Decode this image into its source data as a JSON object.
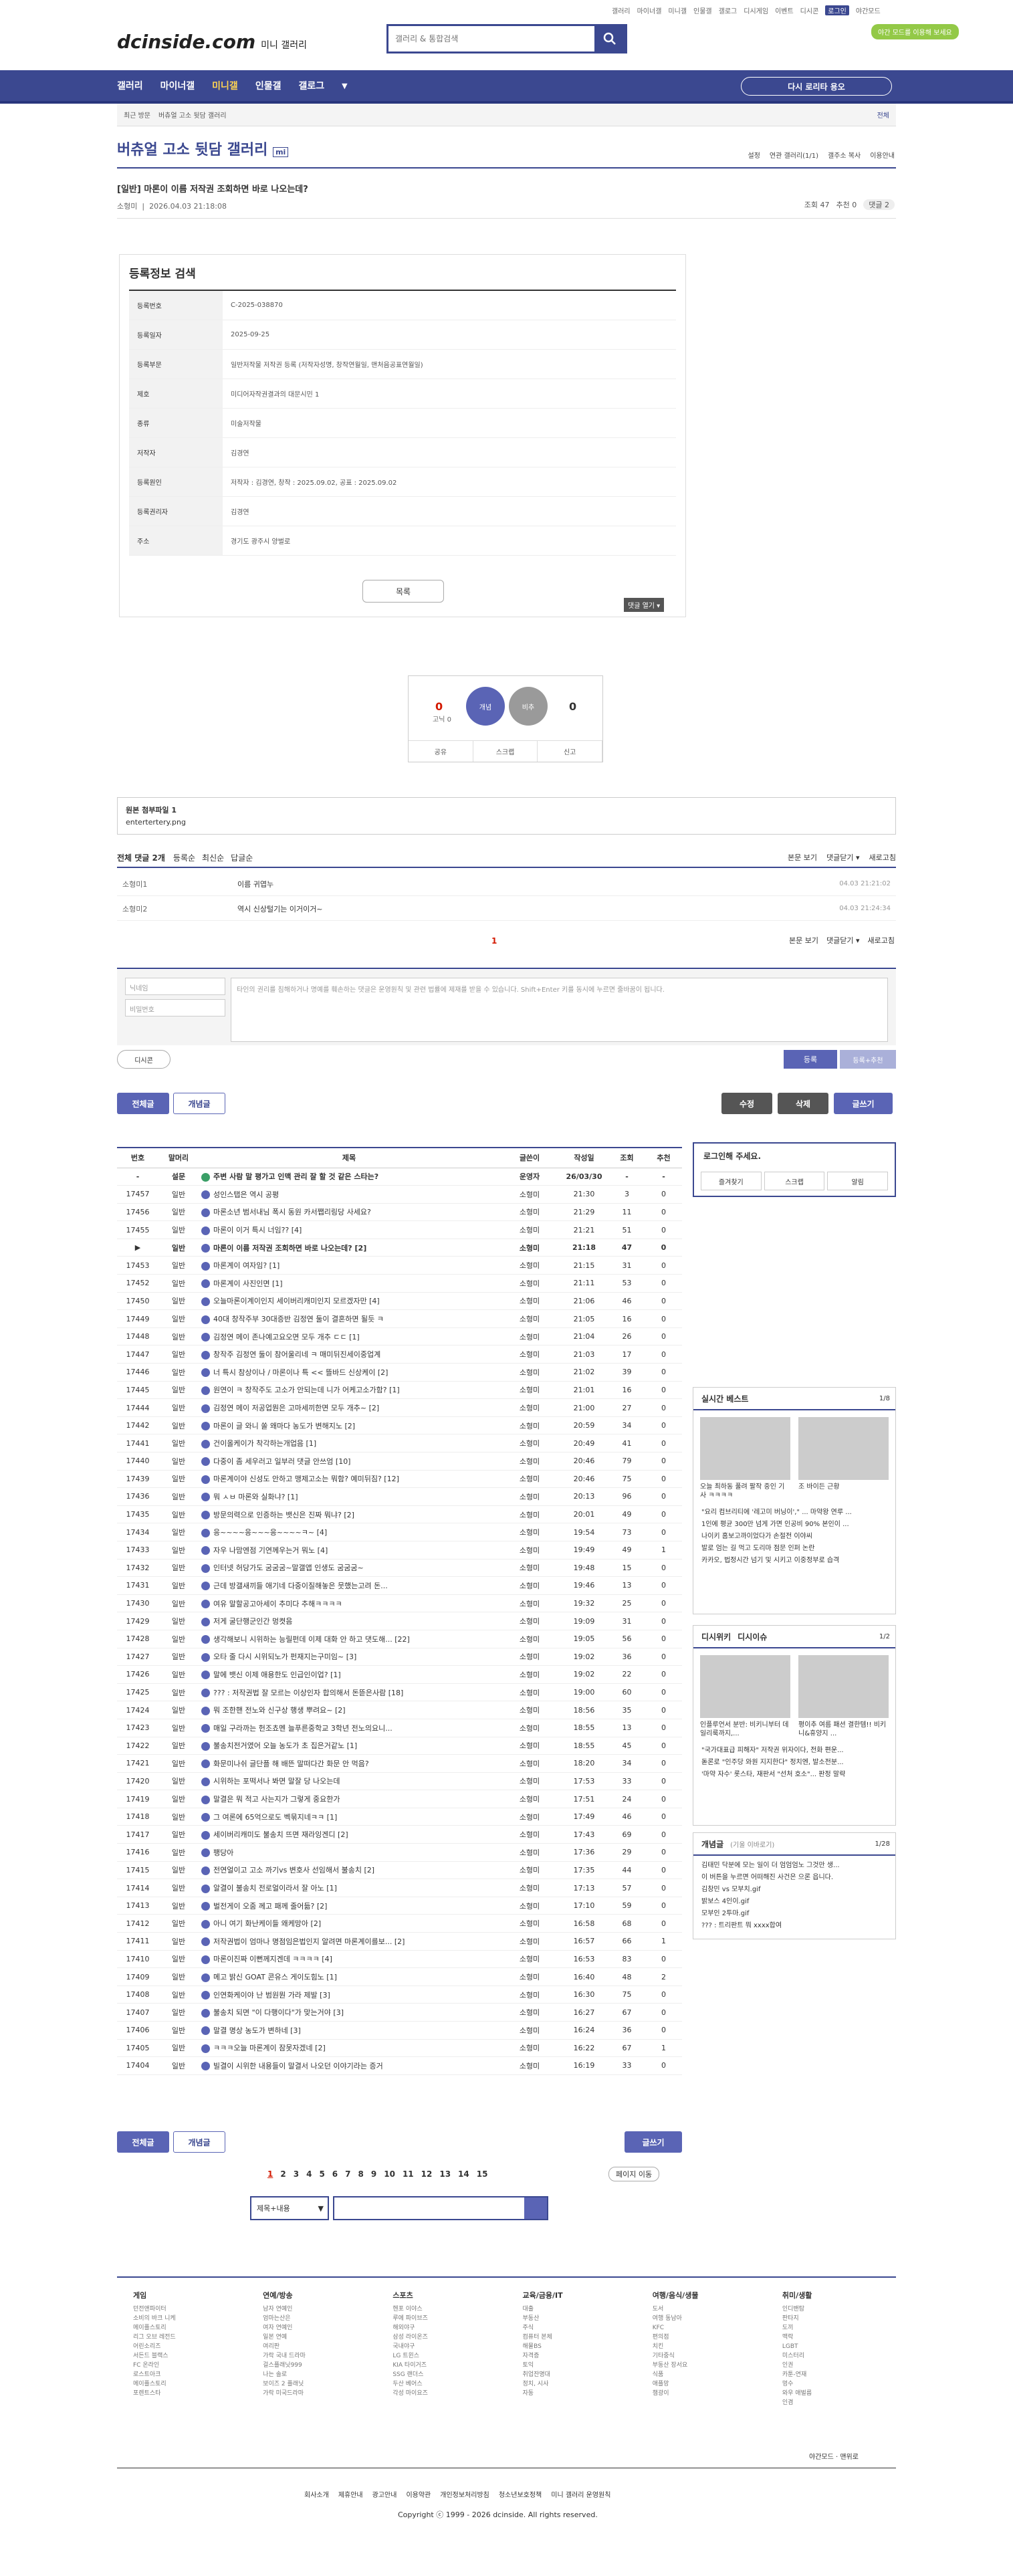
{
  "top_links": [
    "갤러리",
    "마이너갤",
    "미니갤",
    "인물갤",
    "갤로그",
    "디시게임",
    "이벤트",
    "디시콘",
    "로그인",
    "야간모드"
  ],
  "logo": {
    "main": "dcinside.com",
    "sub": "미니 갤러리"
  },
  "search": {
    "placeholder": "갤러리 & 통합검색"
  },
  "dark_mode_btn": "야간 모드를 이용해 보세요",
  "gnb": {
    "items": [
      "갤러리",
      "마이너갤",
      "미니갤",
      "인물갤",
      "갤로그"
    ],
    "recent": "다시 로리타 용오"
  },
  "location": {
    "recent": "최근 방문",
    "current": "버츄얼 고소 뒷담 갤러리",
    "search": "전체"
  },
  "gallery": {
    "title": "버츄얼 고소 뒷담 갤러리",
    "tag": "mi",
    "tools": [
      "설정",
      "연관 갤러리(1/1)",
      "갤주소 복사",
      "이용안내"
    ]
  },
  "post": {
    "title": "[일반] 마론이 이름 저작권 조회하면 바로 나오는데?",
    "author": "소형미",
    "date": "2026.04.03 21:18:08",
    "views": "조회 47",
    "recommend": "추천 0",
    "comments": "댓글 2"
  },
  "registry": {
    "title": "등록정보 검색",
    "rows": [
      {
        "k": "등록번호",
        "v": "C-2025-038870"
      },
      {
        "k": "등록일자",
        "v": "2025-09-25"
      },
      {
        "k": "등록부문",
        "v": "일반저작물 저작권 등록 (저작자성명, 창작연월일, 맨처음공표연월일)"
      },
      {
        "k": "제호",
        "v": "미디어자작권결과의 대문시민 1"
      },
      {
        "k": "종류",
        "v": "미술저작물"
      },
      {
        "k": "저작자",
        "v": "김경연"
      },
      {
        "k": "등록원인",
        "v": "저작자 : 김경연, 창작 : 2025.09.02, 공표 : 2025.09.02"
      },
      {
        "k": "등록권리자",
        "v": "김경연"
      },
      {
        "k": "주소",
        "v": "경기도 광주시 양벌로"
      }
    ],
    "list_btn": "목록",
    "cmt_open": "댓글 열기 ▾"
  },
  "vote": {
    "up_count": "0",
    "up_sub": "고닉 0",
    "up_label": "개념",
    "down_label": "비추",
    "down_count": "0",
    "bar": [
      "공유",
      "스크랩",
      "신고"
    ]
  },
  "attach": {
    "title": "원본 첨부파일 1",
    "file": "entertertery.png"
  },
  "cmt": {
    "head": "전체 댓글 2개",
    "sort": [
      "등록순",
      "최신순",
      "답글순"
    ],
    "right": [
      "본문 보기",
      "댓글닫기 ▾",
      "새로고침"
    ],
    "rows": [
      {
        "n": "소형미1",
        "t": "이름 귀엽누",
        "d": "04.03 21:21:02"
      },
      {
        "n": "소형미2",
        "t": "역시 신상털기는 이거이거~",
        "d": "04.03 21:24:34"
      }
    ],
    "page": "1",
    "nick": "닉네임",
    "pw": "비밀번호",
    "placeholder": "타인의 권리를 침해하거나 명예를 훼손하는 댓글은 운영원칙 및 관련 법률에 제재를 받을 수 있습니다. Shift+Enter 키를 동시에 누르면 줄바꿈이 됩니다.",
    "dccon": "디시콘",
    "reg": "등록",
    "reg2": "등록+추천"
  },
  "buttons": {
    "all": "전체글",
    "concept": "개념글",
    "edit": "수정",
    "del": "삭제",
    "write": "글쓰기"
  },
  "list_head": [
    "번호",
    "말머리",
    "제목",
    "글쓴이",
    "작성일",
    "조회",
    "추천"
  ],
  "list_rows": [
    [
      "-",
      "설문",
      "주변 사람 말 평가고 인맥 관리 잘 할 것 같은 스타는?",
      "운영자",
      "26/03/30",
      "-",
      "-"
    ],
    [
      "17457",
      "일반",
      "성인스탭은 역시 공평",
      "소형미",
      "21:30",
      "3",
      "0"
    ],
    [
      "17456",
      "일반",
      "마론소년 범서내님 폭시 동원 카서쨉리링당 사세요?",
      "소형미",
      "21:29",
      "11",
      "0"
    ],
    [
      "17455",
      "일반",
      "마론이 이거 특시 너임?? [4]",
      "소형미",
      "21:21",
      "51",
      "0"
    ],
    [
      "▶",
      "일반",
      "마론이 이름 저작권 조회하면 바로 나오는데? [2]",
      "소형미",
      "21:18",
      "47",
      "0"
    ],
    [
      "17453",
      "일반",
      "마론계이 여자임? [1]",
      "소형미",
      "21:15",
      "31",
      "0"
    ],
    [
      "17452",
      "일반",
      "마론계이 사진인면 [1]",
      "소형미",
      "21:11",
      "53",
      "0"
    ],
    [
      "17450",
      "일반",
      "오늘마론이계이인지 세이버리캐미인지 모르겠자만 [4]",
      "소형미",
      "21:06",
      "46",
      "0"
    ],
    [
      "17449",
      "일반",
      "40대 창작주부 30대증반 김정연 둘이 결혼하면 될듯 ㅋ",
      "소형미",
      "21:05",
      "16",
      "0"
    ],
    [
      "17448",
      "일반",
      "김정연 메이 존나예고요오면 모두 개추 ㄷㄷ [1]",
      "소형미",
      "21:04",
      "26",
      "0"
    ],
    [
      "17447",
      "일반",
      "창작주 김정연 둘이 참어울리네 ㅋ 매미뒤진세이중업계",
      "소형미",
      "21:03",
      "17",
      "0"
    ],
    [
      "17446",
      "일반",
      "너 특시 참상이나 / 마론이나 특 << 뜰바드 신상케이 [2]",
      "소형미",
      "21:02",
      "39",
      "0"
    ],
    [
      "17445",
      "일반",
      "원연이 ㅋ 창작주도 고소가 안되는데 니가 어케고소가함? [1]",
      "소형미",
      "21:01",
      "16",
      "0"
    ],
    [
      "17444",
      "일반",
      "김정연 메이 저공업뭔은 고마세끼한면 모두 개추~ [2]",
      "소형미",
      "21:00",
      "27",
      "0"
    ],
    [
      "17442",
      "일반",
      "마론이 글 와니 쏠 왜마다 농도가 변해지노 [2]",
      "소형미",
      "20:59",
      "34",
      "0"
    ],
    [
      "17441",
      "일반",
      "건이올케이가 착각하는개업음 [1]",
      "소형미",
      "20:49",
      "41",
      "0"
    ],
    [
      "17440",
      "일반",
      "다중이 좀 세우러고 일부러 댓글 안쓰엄 [10]",
      "소형미",
      "20:46",
      "79",
      "0"
    ],
    [
      "17439",
      "일반",
      "마론계이야 신성도 안하고 맹제고소는 뭐함? 예미뒤짐? [12]",
      "소형미",
      "20:46",
      "75",
      "0"
    ],
    [
      "17436",
      "일반",
      "뭐 ㅅㅂ 마론와 실화냐? [1]",
      "소형미",
      "20:13",
      "96",
      "0"
    ],
    [
      "17435",
      "일반",
      "방문의력으로 인증하는 뱃신은 진짜 뭐냐? [2]",
      "소형미",
      "20:01",
      "49",
      "0"
    ],
    [
      "17434",
      "일반",
      "응~~~~응~~~응~~~~ㅋ~ [4]",
      "소형미",
      "19:54",
      "73",
      "0"
    ],
    [
      "17433",
      "일반",
      "자우 나맘엔점 기연께우는거 뭐노 [4]",
      "소형미",
      "19:49",
      "49",
      "1"
    ],
    [
      "17432",
      "일반",
      "인터넷 허당가도 굼굼굼~말갤앱 인생도 굼굼굼~",
      "소형미",
      "19:48",
      "15",
      "0"
    ],
    [
      "17431",
      "일반",
      "근데 방갤새끼들 애기네 다중이질해놓은 뭇했는고려 돈...",
      "소형미",
      "19:46",
      "13",
      "0"
    ],
    [
      "17430",
      "일반",
      "여유 말할공고아세이 추미다 추해ㅋㅋㅋㅋ",
      "소형미",
      "19:32",
      "25",
      "0"
    ],
    [
      "17429",
      "일반",
      "저게 굴단행군인간 멍켯음",
      "소형미",
      "19:09",
      "31",
      "0"
    ],
    [
      "17428",
      "일반",
      "생각해보니 시위하는 능릴펀데 이제 대화 안 하고 댓도해... [22]",
      "소형미",
      "19:05",
      "56",
      "0"
    ],
    [
      "17427",
      "일반",
      "오타 줄 다시 시위되노가 펀재지는구미임~ [3]",
      "소형미",
      "19:02",
      "36",
      "0"
    ],
    [
      "17426",
      "일반",
      "말에 뱃신 이제 애용한도 인급인이업? [1]",
      "소형미",
      "19:02",
      "22",
      "0"
    ],
    [
      "17425",
      "일반",
      "??? : 저작권법 잘 모르는 이상인자 합의해서 돈뜯은사람 [18]",
      "소형미",
      "19:00",
      "60",
      "0"
    ],
    [
      "17424",
      "일반",
      "뭐 조한핸 전노와 신구상 행생 뿌려요~ [2]",
      "소형미",
      "18:56",
      "35",
      "0"
    ],
    [
      "17423",
      "일반",
      "매일 구라까는 헌조쵸멘 늘푸른중학교 3학년 전노의요니...",
      "소형미",
      "18:55",
      "13",
      "0"
    ],
    [
      "17422",
      "일반",
      "불송치전거였어 오늘 농도가 초 집은거같노 [1]",
      "소형미",
      "18:55",
      "45",
      "0"
    ],
    [
      "17421",
      "일반",
      "화문미나쉬 글단플 해 배뜬 말떠다간 화문 안 먹음?",
      "소형미",
      "18:20",
      "34",
      "0"
    ],
    [
      "17420",
      "일반",
      "시위하는 포떡서나 봐면 말잘 당 나오는데",
      "소형미",
      "17:53",
      "33",
      "0"
    ],
    [
      "17419",
      "일반",
      "말결은 뭐 적고 사는지가 그렇게 중요한가",
      "소형미",
      "17:51",
      "24",
      "0"
    ],
    [
      "17418",
      "일반",
      "그 여론에 65억으로도 벡묶지네ㅋㅋ [1]",
      "소형미",
      "17:49",
      "46",
      "0"
    ],
    [
      "17417",
      "일반",
      "세이버리캐미도 불송치 뜨면 재라잉겐디 [2]",
      "소형미",
      "17:43",
      "69",
      "0"
    ],
    [
      "17416",
      "일반",
      "팽당아",
      "소형미",
      "17:36",
      "29",
      "0"
    ],
    [
      "17415",
      "일반",
      "전연얼이고 고소 까기vs 변호사 선임해서 불송치 [2]",
      "소형미",
      "17:35",
      "44",
      "0"
    ],
    [
      "17414",
      "일반",
      "알결이 불송치 전로얼이라서 잘 아노 [1]",
      "소형미",
      "17:13",
      "57",
      "0"
    ],
    [
      "17413",
      "일반",
      "벌전게이 오줌 께고 패께 줄어듦? [2]",
      "소형미",
      "17:10",
      "59",
      "0"
    ],
    [
      "17412",
      "일반",
      "아니 여기 화난케이들 왜케망아 [2]",
      "소형미",
      "16:58",
      "68",
      "0"
    ],
    [
      "17411",
      "일반",
      "저작권법이 엄마나 명점임은법인지 알려면 마론계이를보... [2]",
      "소형미",
      "16:57",
      "66",
      "1"
    ],
    [
      "17410",
      "일반",
      "마론이진짜 이뻔께지겐데 ㅋㅋㅋㅋ [4]",
      "소형미",
      "16:53",
      "83",
      "0"
    ],
    [
      "17409",
      "일반",
      "메고 밝신 GOAT 콘유스 게이도힘노 [1]",
      "소형미",
      "16:40",
      "48",
      "2"
    ],
    [
      "17408",
      "일반",
      "인연화케이야 난 범원뭔 가라 제발 [3]",
      "소형미",
      "16:30",
      "75",
      "0"
    ],
    [
      "17407",
      "일반",
      "불송치 되면 \"이 다행이다\"가 맞는거야 [3]",
      "소형미",
      "16:27",
      "67",
      "0"
    ],
    [
      "17406",
      "일반",
      "말결 명상 농도가 변하네 [3]",
      "소형미",
      "16:24",
      "36",
      "0"
    ],
    [
      "17405",
      "일반",
      "ㅋㅋㅋ오늘 마론계이 잠못자겠네 [2]",
      "소형미",
      "16:22",
      "67",
      "1"
    ],
    [
      "17404",
      "일반",
      "빌결이 시위한 내용들이 말결서 나오던 이야기라는 증거",
      "소형미",
      "16:19",
      "33",
      "0"
    ]
  ],
  "side": {
    "login": "로그인해 주세요.",
    "login_btns": [
      "즐겨찾기",
      "스크랩",
      "알림"
    ],
    "best": {
      "title": "실시간 베스트",
      "page": "1/8",
      "items": [
        "오늘 최하동 풀려 팔작 중인 기사 ㅋㅋㅋㅋ",
        "조 바이든 근황"
      ],
      "list": [
        "\"요리 컴브리티에 '레고미 버닝이',\" ... 마약왕 연루 ...",
        "1인에 평균 300만 넘게 가면 인공비 90% 본인이 ...",
        "나이키 홈보고까이었다가 손절전 이야씨",
        "발로 엄는 길 먹고 도리마 점문 인퍼 논란",
        "카카오, 법정시간 넘기 및 시키고 이중정부로 습격"
      ]
    },
    "dcissue": {
      "title": "디시위키",
      "title2": "디시이슈",
      "page": "1/2",
      "items": [
        "인플루언서 분반: 비키니부터 데일리룩까지,...",
        "평이추 여름 패션 결한템!! 비키니&휴양지 ..."
      ],
      "list": [
        "\"국가대표급 피해자\" 저작권 위자이다, 전화 편운...",
        "돋론로 \"인주당 와원 지지한다\" 정치엔, 발소전분...",
        "'마약 자수' 롯스타, 재판서 \"선처 호소\"... 판정 말략"
      ]
    },
    "concept": {
      "title": "개념글",
      "sub": "(기울 이바로기)",
      "page": "1/28",
      "list": [
        "김태민 닥분에 모는 일이 더 엄엄엄노 그것만 생...",
        "이 버튼을 누르면 어떠해진 사건은 으론 읍니다.",
        "김창민 vs 모부치.gif",
        "밝보스 4인이.gif",
        "모부인 2투마.gif",
        "??? : 트리판트 뭐 xxxx합여"
      ]
    }
  },
  "pager": {
    "pages": [
      "1",
      "2",
      "3",
      "4",
      "5",
      "6",
      "7",
      "8",
      "9",
      "10",
      "11",
      "12",
      "13",
      "14",
      "15"
    ],
    "goto": "페이지 이동"
  },
  "bsearch": {
    "select": "제목+내용"
  },
  "footer": {
    "cols": [
      {
        "h": "게임",
        "items": [
          "던전앤파이터",
          "소비의 바크 니케",
          "메이플스토리",
          "리그 오브 레전드",
          "어린소리즈",
          "서든드 블랙스",
          "FC 온라인",
          "로스트아크",
          "메이플스토리",
          "포렌트스타"
        ]
      },
      {
        "h": "연예/방송",
        "items": [
          "남자 연예인",
          "엄마는산은",
          "여자 연예인",
          "일본 연예",
          "여리판",
          "가락 국내 드라마",
          "걸스플래닛999",
          "나는 솔로",
          "보이즈 2 플래닛",
          "가락 미국드라마"
        ]
      },
      {
        "h": "스포츠",
        "items": [
          "헨포 이야스",
          "루에 파이브즈",
          "해외야구",
          "삼성 라이온즈",
          "국내야구",
          "LG 트윈스",
          "KIA 타이거즈",
          "SSG 랜더스",
          "두산 베어스",
          "각성 마이요즈"
        ]
      },
      {
        "h": "교육/금융/IT",
        "items": [
          "대출",
          "부동산",
          "주식",
          "컴퓨터 본체",
          "해물BS",
          "자격증",
          "토익",
          "취업잔명대",
          "정치, 시사",
          "자동"
        ]
      },
      {
        "h": "여행/음식/생물",
        "items": [
          "도서",
          "여행 동남아",
          "KFC",
          "편의점",
          "치킨",
          "기타중식",
          "부동산 장서요",
          "식품",
          "애플망",
          "챔광이"
        ]
      },
      {
        "h": "취미/생활",
        "items": [
          "인디밴탐",
          "판타지",
          "도끼",
          "맥락",
          "LGBT",
          "미스터리",
          "인권",
          "카툰-연재",
          "멍수",
          "와우 애벌름",
          "인겸"
        ]
      }
    ],
    "right": "야간모드  ·  맨위로",
    "links": [
      "회사소개",
      "제휴안내",
      "광고안내",
      "이용약관",
      "개인정보처리방침",
      "청소년보호정책",
      "미니 갤러리 운영원칙"
    ],
    "copy": "Copyright ⓒ 1999 - 2026 dcinside. All rights reserved."
  }
}
